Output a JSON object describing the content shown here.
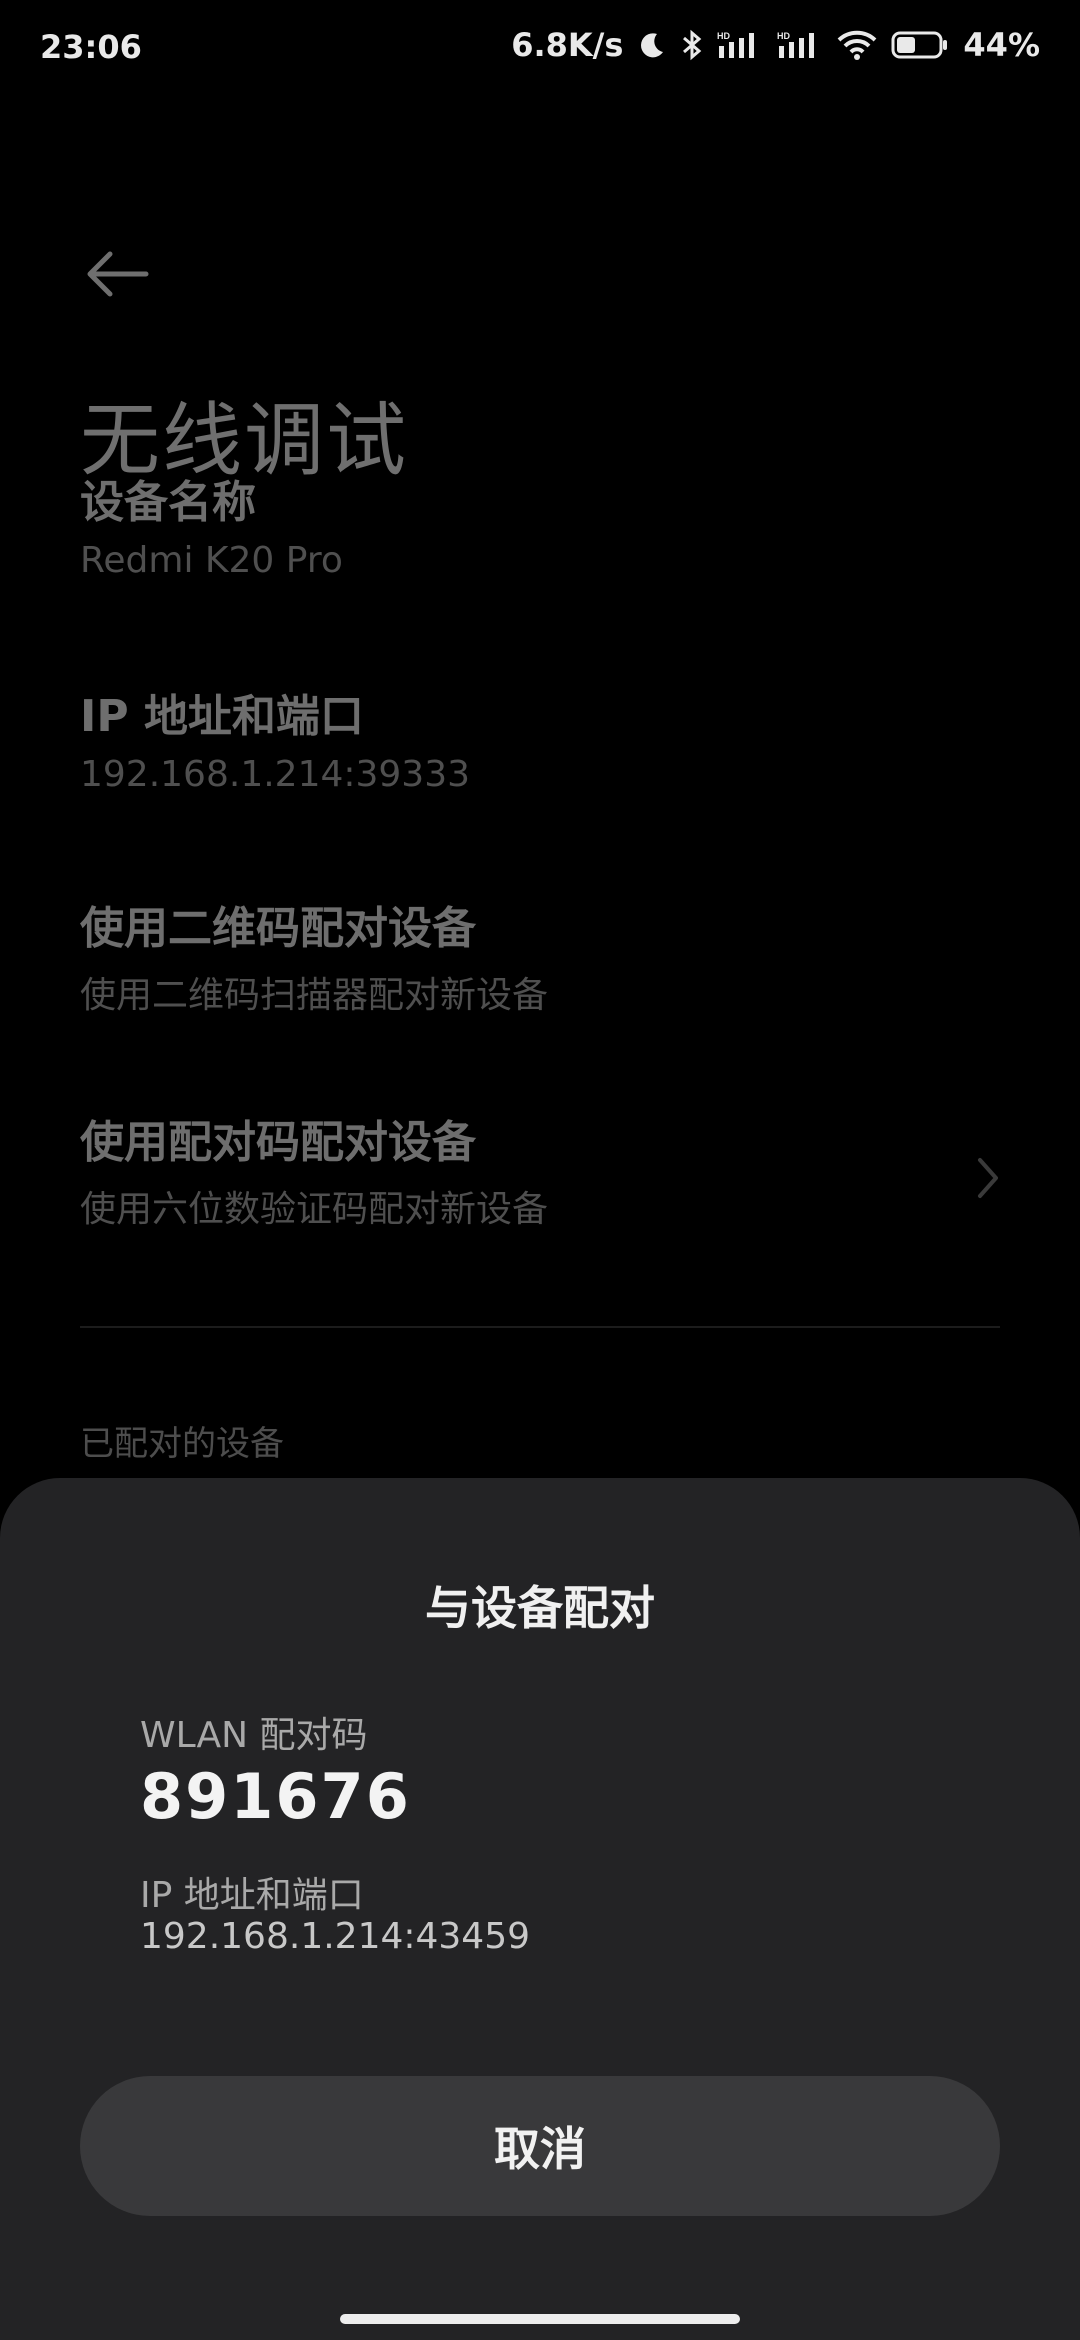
{
  "status_bar": {
    "time": "23:06",
    "net_speed": "6.8K/s",
    "battery_percent": "44%",
    "icons": [
      "do-not-disturb-icon",
      "bluetooth-icon",
      "hd-signal-icon",
      "hd-signal-icon",
      "wifi-icon",
      "battery-icon"
    ]
  },
  "page": {
    "title": "无线调试",
    "items": [
      {
        "title": "设备名称",
        "subtitle": "Redmi K20 Pro"
      },
      {
        "title": "IP 地址和端口",
        "subtitle": "192.168.1.214:39333"
      },
      {
        "title": "使用二维码配对设备",
        "subtitle": "使用二维码扫描器配对新设备"
      },
      {
        "title": "使用配对码配对设备",
        "subtitle": "使用六位数验证码配对新设备"
      }
    ],
    "paired_section_label": "已配对的设备"
  },
  "dialog": {
    "title": "与设备配对",
    "code_label": "WLAN 配对码",
    "code_value": "891676",
    "ip_label": "IP 地址和端口",
    "ip_value": "192.168.1.214:43459",
    "cancel_label": "取消"
  },
  "colors": {
    "background": "#000000",
    "sheet": "#232325",
    "button": "#39393b"
  }
}
